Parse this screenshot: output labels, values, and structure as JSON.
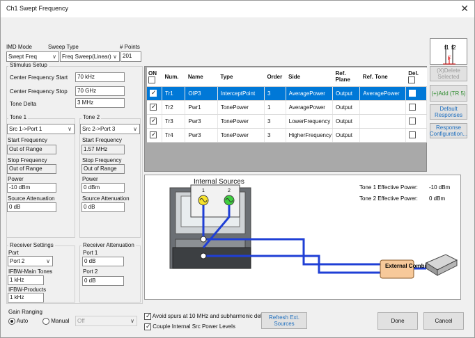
{
  "window": {
    "title": "Ch1 Swept Frequency",
    "close": "✕"
  },
  "imd": {
    "mode_label": "IMD Mode",
    "mode_value": "Swept Freq",
    "sweep_type_label": "Sweep Type",
    "sweep_type_value": "Freq Sweep(Linear)",
    "points_label": "# Points",
    "points_value": "201"
  },
  "stimulus": {
    "title": "Stimulus Setup",
    "center_start_label": "Center Frequency Start",
    "center_start": "70 kHz",
    "center_stop_label": "Center Frequency Stop",
    "center_stop": "70 GHz",
    "tone_delta_label": "Tone Delta",
    "tone_delta": "3 MHz"
  },
  "tone1": {
    "title": "Tone 1",
    "source": "Src 1->Port 1",
    "start_label": "Start Frequency",
    "start": "Out of Range",
    "stop_label": "Stop Frequency",
    "stop": "Out of Range",
    "power_label": "Power",
    "power": "-10 dBm",
    "atten_label": "Source Attenuation",
    "atten": "0 dB"
  },
  "tone2": {
    "title": "Tone 2",
    "source": "Src 2->Port 3",
    "start_label": "Start Frequency",
    "start": "1.57 MHz",
    "stop_label": "Stop Frequency",
    "stop": "Out of Range",
    "power_label": "Power",
    "power": "0 dBm",
    "atten_label": "Source Attenuation",
    "atten": "0 dB"
  },
  "receiver": {
    "title": "Receiver Settings",
    "port_label": "Port",
    "port_value": "Port 2",
    "ifbw_main_label": "IFBW-Main Tones",
    "ifbw_main": "1 kHz",
    "ifbw_products_label": "IFBW-Products",
    "ifbw_products": "1 kHz",
    "atten_title": "Receiver Attenuation",
    "port1_label": "Port 1",
    "port1": "0 dB",
    "port2_label": "Port 2",
    "port2": "0 dB"
  },
  "gain": {
    "title": "Gain Ranging",
    "auto": "Auto",
    "manual": "Manual",
    "value": "Off"
  },
  "table": {
    "headers": {
      "on": "ON",
      "num": "Num.",
      "name": "Name",
      "type": "Type",
      "order": "Order",
      "side": "Side",
      "ref_plane": "Ref. Plane",
      "ref_tone": "Ref. Tone",
      "del": "Del."
    },
    "rows": [
      {
        "num": "Tr1",
        "name": "OIP3",
        "type": "InterceptPoint",
        "order": "3",
        "side": "AveragePower",
        "ref_plane": "Output",
        "ref_tone": "AveragePower"
      },
      {
        "num": "Tr2",
        "name": "Pwr1",
        "type": "TonePower",
        "order": "1",
        "side": "AveragePower",
        "ref_plane": "Output",
        "ref_tone": ""
      },
      {
        "num": "Tr3",
        "name": "Pwr3",
        "type": "TonePower",
        "order": "3",
        "side": "LowerFrequency",
        "ref_plane": "Output",
        "ref_tone": ""
      },
      {
        "num": "Tr4",
        "name": "Pwr3",
        "type": "TonePower",
        "order": "3",
        "side": "HigherFrequency",
        "ref_plane": "Output",
        "ref_tone": ""
      }
    ]
  },
  "side_buttons": {
    "delete": "(X)Delete Selected",
    "add": "(+)Add (TR 5)",
    "default": "Default Responses",
    "response": "Response Configuration..."
  },
  "preview": {
    "f1": "f1",
    "f2": "f2",
    "fo": "F"
  },
  "diagram": {
    "internal_sources": "Internal Sources",
    "src1": "1",
    "src2": "2",
    "tone1_power_label": "Tone 1 Effective Power:",
    "tone1_power": "-10 dBm",
    "tone2_power_label": "Tone 2 Effective Power:",
    "tone2_power": "0 dBm",
    "combiner": "External Combiner"
  },
  "footer": {
    "avoid_spurs": "Avoid spurs at 10 MHz and subharmonic deltas",
    "couple": "Couple Internal Src Power Levels",
    "refresh": "Refresh Ext. Sources",
    "done": "Done",
    "cancel": "Cancel"
  }
}
